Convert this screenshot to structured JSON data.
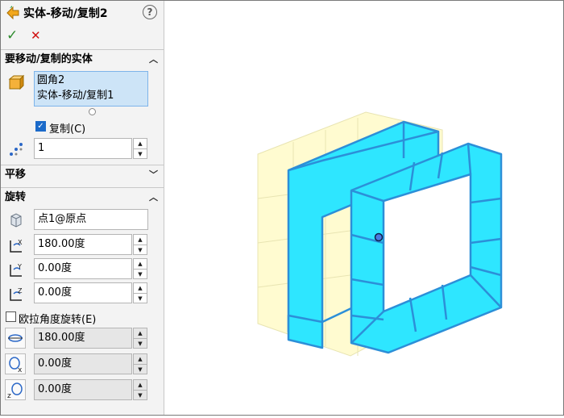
{
  "header": {
    "title": "实体-移动/复制2",
    "help": "?"
  },
  "actions": {
    "ok": "✓",
    "cancel": "✕"
  },
  "bodies_section": {
    "title": "要移动/复制的实体",
    "items": [
      "圆角2",
      "实体-移动/复制1"
    ],
    "copy_label": "复制(C)",
    "copy_checked": true,
    "count": "1"
  },
  "translate_section": {
    "title": "平移",
    "expanded": false
  },
  "rotate_section": {
    "title": "旋转",
    "point": "点1@原点",
    "angle_x": "180.00度",
    "angle_y": "0.00度",
    "angle_z": "0.00度",
    "euler_label": "欧拉角度旋转(E)",
    "euler_checked": false,
    "euler_1": "180.00度",
    "euler_2": "0.00度",
    "euler_3": "0.00度"
  },
  "colors": {
    "accent": "#1b6ac9",
    "ok": "#2e8b2e",
    "cancel": "#d01010",
    "cyan": "#2ee6ff",
    "cyan_edge": "#2c8fd8",
    "ghost": "#fffbd0"
  }
}
